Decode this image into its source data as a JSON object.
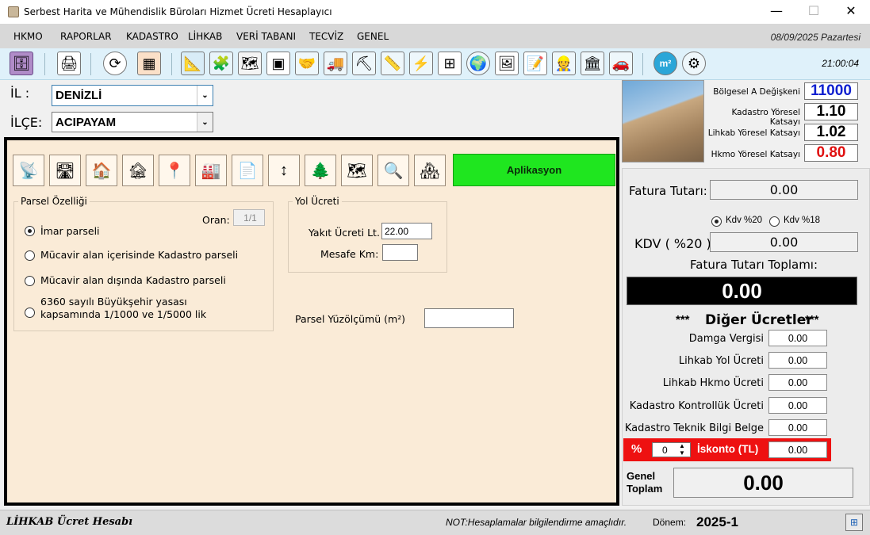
{
  "window": {
    "title": "Serbest Harita ve Mühendislik Büroları Hizmet Ücreti Hesaplayıcı",
    "minimize": "—",
    "maximize": "☐",
    "close": "✕"
  },
  "menu": {
    "items": [
      "HKMO",
      "RAPORLAR",
      "KADASTRO",
      "LİHKAB",
      "VERİ TABANI",
      "TECVİZ",
      "GENEL"
    ],
    "date": "08/09/2025 Pazartesi"
  },
  "toolbar": {
    "time": "21:00:04",
    "icons": [
      "database-icon",
      "document-print-icon",
      "refresh-icon",
      "map-grid-icon",
      "blueprint-icon",
      "puzzle-icon",
      "map-board-icon",
      "floorplan-icon",
      "handshake-icon",
      "survey-truck-icon",
      "mining-icon",
      "total-station-icon",
      "power-tower-icon",
      "parcel-map-icon",
      "globe-pin-icon",
      "map-frame-icon",
      "map-edit-icon",
      "surveyor-desk-icon",
      "building-icon",
      "car-parking-icon",
      "m2-icon",
      "gears-icon"
    ]
  },
  "location": {
    "il_label": "İL   :",
    "il_value": "DENİZLİ",
    "ilce_label": "İLÇE:",
    "ilce_value": "ACIPAYAM"
  },
  "panel": {
    "action_button": "Aplikasyon",
    "icons": [
      "surveyor-tripod-icon",
      "road-icon",
      "house-pin-icon",
      "cracked-house-icon",
      "map-pin-icon",
      "factory-icon",
      "zoning-doc-icon",
      "vertical-arrows-icon",
      "forest-board-icon",
      "site-plan-icon",
      "magnifier-globe-icon",
      "house-handshake-icon"
    ],
    "parsel_group": {
      "title": "Parsel Özelliği",
      "oran_label": "Oran:",
      "oran_value": "1/1",
      "options": [
        "İmar parseli",
        "Mücavir alan içerisinde Kadastro parseli",
        "Mücavir alan dışında Kadastro parseli",
        "6360 sayılı Büyükşehir yasası",
        "kapsamında 1/1000 ve 1/5000 lik"
      ]
    },
    "yol_group": {
      "title": "Yol Ücreti",
      "yakit_label": "Yakıt Ücreti Lt.",
      "yakit_value": "22.00",
      "mesafe_label": "Mesafe Km:",
      "mesafe_value": ""
    },
    "yuzolcumu_label": "Parsel Yüzölçümü (m²)",
    "yuzolcumu_value": ""
  },
  "coefficients": {
    "items": [
      {
        "label": "Bölgesel A Değişkeni",
        "value": "11000",
        "color": "#1020d0"
      },
      {
        "label": "Kadastro Yöresel Katsayı",
        "value": "1.10",
        "color": "#000000"
      },
      {
        "label": "Lihkab Yöresel Katsayı",
        "value": "1.02",
        "color": "#000000"
      },
      {
        "label": "Hkmo Yöresel Katsayı",
        "value": "0.80",
        "color": "#e01010"
      }
    ]
  },
  "invoice": {
    "fatura_label": "Fatura Tutarı:",
    "fatura_value": "0.00",
    "kdv20_label": "Kdv %20",
    "kdv18_label": "Kdv %18",
    "kdv_label": "KDV ( %20 ):",
    "kdv_value": "0.00",
    "toplam_label": "Fatura Tutarı Toplamı:",
    "toplam_value": "0.00",
    "other_title_stars_left": "***",
    "other_title": "Diğer Ücretler",
    "other_title_stars_right": "***",
    "fees": [
      {
        "label": "Damga Vergisi",
        "value": "0.00"
      },
      {
        "label": "Lihkab Yol Ücreti",
        "value": "0.00"
      },
      {
        "label": "Lihkab Hkmo Ücreti",
        "value": "0.00"
      },
      {
        "label": "Kadastro Kontrollük Ücreti",
        "value": "0.00"
      },
      {
        "label": "Kadastro Teknik Bilgi Belge",
        "value": "0.00"
      }
    ],
    "iskonto_percent_sign": "%",
    "iskonto_percent_value": "0",
    "iskonto_label": "İskonto (TL)",
    "iskonto_value": "0.00",
    "genel_label_1": "Genel",
    "genel_label_2": "Toplam",
    "genel_value": "0.00"
  },
  "status": {
    "left": "LİHKAB Ücret Hesabı",
    "note": "NOT:Hesaplamalar bilgilendirme amaçlıdır.",
    "donem_label": "Dönem:",
    "donem_value": "2025-1"
  }
}
